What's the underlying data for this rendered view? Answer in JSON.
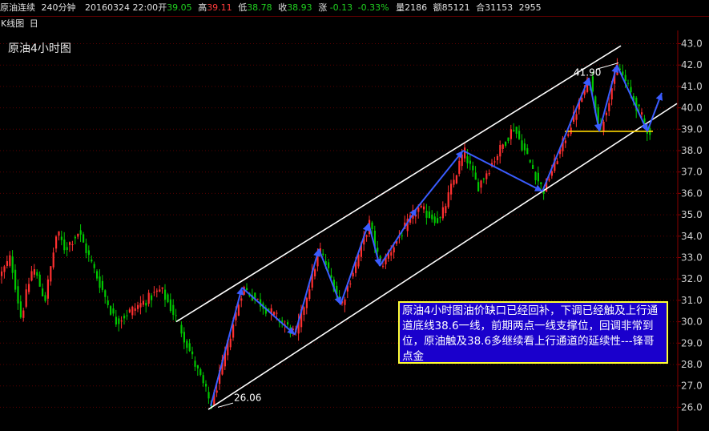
{
  "header": {
    "symbol": "原油连续",
    "period": "240分钟",
    "datetime": "20160324 22:00",
    "open_label": "开",
    "open": "39.05",
    "high_label": "高",
    "high": "39.11",
    "low_label": "低",
    "low": "38.78",
    "close_label": "收",
    "close": "38.93",
    "change_label": "涨",
    "change": "-0.13",
    "change_pct": "-0.33%",
    "volume_label": "量",
    "volume": "2186",
    "amount_label": "额",
    "amount": "85121",
    "oi_label": "合",
    "oi": "31153",
    "extra": "2955"
  },
  "subbar": {
    "label": "K线图",
    "icon": "日"
  },
  "chart_data": {
    "type": "candlestick",
    "title": "原油4小时图",
    "ylim": [
      25.6,
      43.4
    ],
    "yticks": [
      "43.0",
      "42.0",
      "41.0",
      "40.0",
      "39.0",
      "38.0",
      "37.0",
      "36.0",
      "35.0",
      "34.0",
      "33.0",
      "32.0",
      "31.0",
      "30.0",
      "29.0",
      "28.0",
      "27.0",
      "26.0"
    ],
    "grid": "dotted-horizontal",
    "colors": {
      "up": "#ff3030",
      "down": "#00c800",
      "zigzag": "#3a5cff",
      "channel": "#ffffff",
      "support": "#ffd700"
    },
    "key_points": [
      {
        "x": 97,
        "y": 34.2
      },
      {
        "x": 143,
        "y": 30.0
      },
      {
        "x": 200,
        "y": 31.5
      },
      {
        "x": 221,
        "y": 30.0
      },
      {
        "x": 263,
        "y": 26.06
      },
      {
        "x": 302,
        "y": 31.6
      },
      {
        "x": 368,
        "y": 29.4
      },
      {
        "x": 398,
        "y": 33.4
      },
      {
        "x": 425,
        "y": 30.8
      },
      {
        "x": 460,
        "y": 34.6
      },
      {
        "x": 474,
        "y": 32.6
      },
      {
        "x": 520,
        "y": 35.3
      },
      {
        "x": 548,
        "y": 34.7
      },
      {
        "x": 578,
        "y": 38.0
      },
      {
        "x": 595,
        "y": 36.3
      },
      {
        "x": 640,
        "y": 39.1
      },
      {
        "x": 677,
        "y": 36.1
      },
      {
        "x": 710,
        "y": 39.1
      },
      {
        "x": 735,
        "y": 41.4
      },
      {
        "x": 748,
        "y": 38.9
      },
      {
        "x": 770,
        "y": 42.0
      },
      {
        "x": 808,
        "y": 38.9
      }
    ],
    "zigzag": [
      {
        "x": 263,
        "y": 26.06
      },
      {
        "x": 302,
        "y": 31.6
      },
      {
        "x": 368,
        "y": 29.4
      },
      {
        "x": 398,
        "y": 33.4
      },
      {
        "x": 425,
        "y": 30.8
      },
      {
        "x": 460,
        "y": 34.6
      },
      {
        "x": 474,
        "y": 32.6
      },
      {
        "x": 520,
        "y": 35.3
      },
      {
        "x": 578,
        "y": 38.0
      },
      {
        "x": 677,
        "y": 36.1
      },
      {
        "x": 735,
        "y": 41.4
      },
      {
        "x": 748,
        "y": 38.9
      },
      {
        "x": 770,
        "y": 42.0
      },
      {
        "x": 808,
        "y": 38.9
      },
      {
        "x": 826,
        "y": 40.7
      }
    ],
    "channel_upper": [
      {
        "x": 220,
        "y": 30.0
      },
      {
        "x": 775,
        "y": 42.9
      }
    ],
    "channel_lower": [
      {
        "x": 260,
        "y": 25.9
      },
      {
        "x": 845,
        "y": 40.2
      }
    ],
    "support_line": {
      "y": 38.9,
      "x_from": 705,
      "x_to": 815
    },
    "labels": [
      {
        "text": "26.06",
        "x": 292,
        "y": 26.3
      },
      {
        "text": "41.90",
        "x": 716,
        "y": 41.5
      }
    ],
    "annotation": "原油4小时图油价缺口已经回补，下调已经触及上行通道底线38.6一线，前期两点一线支撑位，回调非常到位，原油触及38.6多继续看上行通道的延续性---锋哥点金"
  }
}
